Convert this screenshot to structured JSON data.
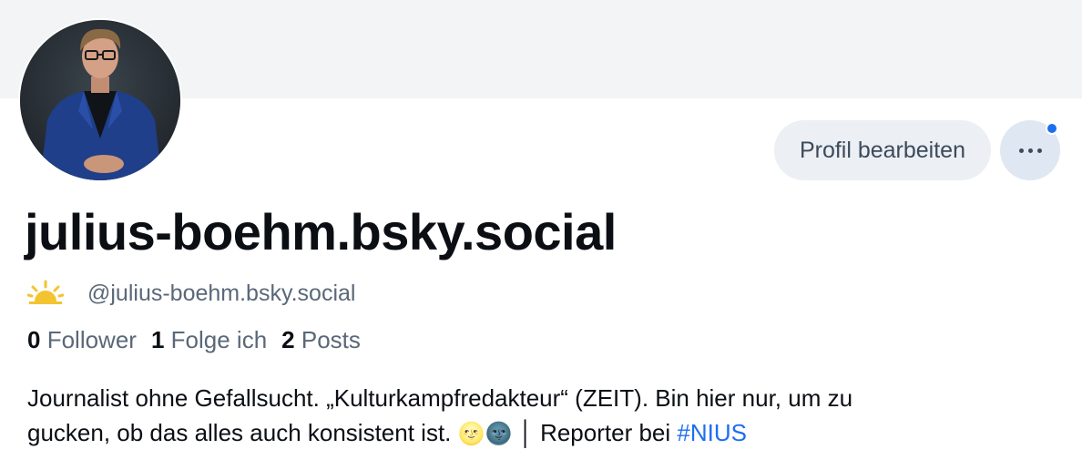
{
  "profile": {
    "display_name": "julius-boehm.bsky.social",
    "handle": "@julius-boehm.bsky.social",
    "avatar_alt": "avatar"
  },
  "actions": {
    "edit_label": "Profil bearbeiten",
    "more_label": "···"
  },
  "stats": {
    "followers_count": "0",
    "followers_label": "Follower",
    "following_count": "1",
    "following_label": "Folge ich",
    "posts_count": "2",
    "posts_label": "Posts"
  },
  "bio": {
    "line1": "Journalist ohne Gefallsucht. „Kulturkampfredakteur“ (ZEIT). Bin hier nur, um zu",
    "line2_text": "gucken, ob das alles auch konsistent ist. ",
    "emoji": "🌝🌚",
    "line2_tail": " │ Reporter bei ",
    "hashtag": "#NIUS"
  },
  "colors": {
    "accent": "#1d6ef0",
    "banner": "#f3f4f6",
    "button_bg": "#eceff3",
    "muted_text": "#5a6878"
  },
  "icons": {
    "handle_icon": "sunrise-icon",
    "notification": "blue-dot"
  }
}
